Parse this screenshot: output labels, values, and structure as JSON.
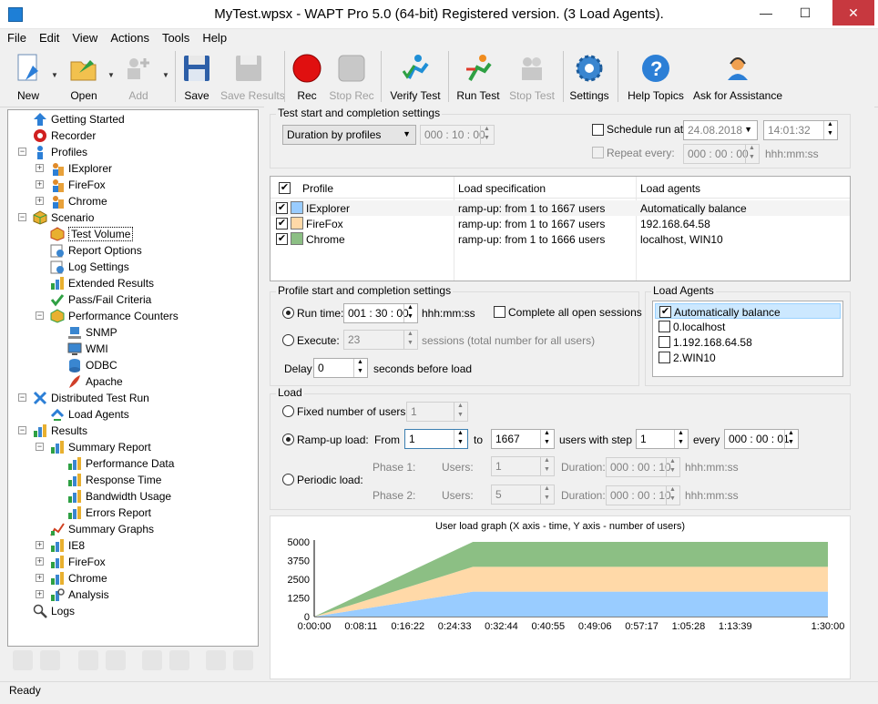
{
  "window": {
    "title": "MyTest.wpsx - WAPT Pro 5.0 (64-bit) Registered version. (3 Load Agents).",
    "min": "—",
    "max": "☐",
    "close": "✕"
  },
  "menu": [
    "File",
    "Edit",
    "View",
    "Actions",
    "Tools",
    "Help"
  ],
  "toolbar": {
    "new": "New",
    "open": "Open",
    "add": "Add",
    "save": "Save",
    "save_results": "Save Results",
    "rec": "Rec",
    "stop_rec": "Stop Rec",
    "verify_test": "Verify Test",
    "run_test": "Run Test",
    "stop_test": "Stop Test",
    "settings": "Settings",
    "help_topics": "Help Topics",
    "ask": "Ask for Assistance"
  },
  "tree": {
    "getting_started": "Getting Started",
    "recorder": "Recorder",
    "profiles": "Profiles",
    "iexplorer": "IExplorer",
    "firefox": "FireFox",
    "chrome": "Chrome",
    "scenario": "Scenario",
    "test_volume": "Test Volume",
    "report_options": "Report Options",
    "log_settings": "Log Settings",
    "extended_results": "Extended Results",
    "pass_fail": "Pass/Fail Criteria",
    "perf_counters": "Performance Counters",
    "snmp": "SNMP",
    "wmi": "WMI",
    "odbc": "ODBC",
    "apache": "Apache",
    "distributed": "Distributed Test Run",
    "load_agents": "Load Agents",
    "results": "Results",
    "summary_report": "Summary Report",
    "performance_data": "Performance Data",
    "response_time": "Response Time",
    "bandwidth_usage": "Bandwidth Usage",
    "errors_report": "Errors Report",
    "summary_graphs": "Summary Graphs",
    "ie8": "IE8",
    "r_firefox": "FireFox",
    "r_chrome": "Chrome",
    "analysis": "Analysis",
    "logs": "Logs"
  },
  "status": "Ready",
  "test_settings": {
    "group": "Test start and completion settings",
    "duration_mode": "Duration by profiles",
    "duration": "000 : 10 : 00",
    "schedule_label": "Schedule run at:",
    "schedule_date": "24.08.2018",
    "schedule_time": "14:01:32",
    "repeat_label": "Repeat every:",
    "repeat_value": "000 : 00 : 00",
    "repeat_unit": "hhh:mm:ss"
  },
  "profiles_table": {
    "headers": [
      "Profile",
      "Load specification",
      "Load agents"
    ],
    "rows": [
      {
        "profile": "IExplorer",
        "spec": "ramp-up: from 1 to 1667 users",
        "agents": "Automatically balance",
        "color": "#99ccff"
      },
      {
        "profile": "FireFox",
        "spec": "ramp-up: from 1 to 1667 users",
        "agents": "192.168.64.58",
        "color": "#ffd9a8"
      },
      {
        "profile": "Chrome",
        "spec": "ramp-up: from 1 to 1666 users",
        "agents": "localhost, WIN10",
        "color": "#8cbf84"
      }
    ]
  },
  "profile_settings": {
    "group": "Profile start and completion settings",
    "run_time_label": "Run time:",
    "run_time": "001 : 30 : 00",
    "run_time_unit": "hhh:mm:ss",
    "complete_open": "Complete all open sessions",
    "execute_label": "Execute:",
    "execute_value": "23",
    "execute_note": "sessions (total number for all users)",
    "delay_label": "Delay",
    "delay_value": "0",
    "delay_note": "seconds before load"
  },
  "load_agents": {
    "group": "Load Agents",
    "items": [
      {
        "label": "Automatically balance",
        "checked": true
      },
      {
        "label": "0.localhost",
        "checked": false
      },
      {
        "label": "1.192.168.64.58",
        "checked": false
      },
      {
        "label": "2.WIN10",
        "checked": false
      }
    ]
  },
  "load": {
    "group": "Load",
    "fixed_label": "Fixed number of users:",
    "fixed_value": "1",
    "ramp_label": "Ramp-up load:",
    "from_label": "From",
    "from_value": "1",
    "to_label": "to",
    "to_value": "1667",
    "step_label": "users with step",
    "step_value": "1",
    "every_label": "every",
    "every_value": "000 : 00 : 01",
    "periodic_label": "Periodic load:",
    "phase1": "Phase 1:",
    "phase2": "Phase 2:",
    "users_label": "Users:",
    "p1_users": "1",
    "p2_users": "5",
    "duration_label": "Duration:",
    "p1_dur": "000 : 00 : 10",
    "p2_dur": "000 : 00 : 10",
    "unit": "hhh:mm:ss"
  },
  "chart_data": {
    "type": "area",
    "title": "User load graph (X axis - time, Y axis - number of users)",
    "xlabel": "",
    "ylabel": "",
    "x": [
      "0:00:00",
      "0:08:11",
      "0:16:22",
      "0:24:33",
      "0:32:44",
      "0:40:55",
      "0:49:06",
      "0:57:17",
      "1:05:28",
      "1:13:39",
      "1:30:00"
    ],
    "x_minutes": [
      0,
      27.8,
      90
    ],
    "ylim": [
      0,
      5000
    ],
    "yticks": [
      0,
      1250,
      2500,
      3750,
      5000
    ],
    "series": [
      {
        "name": "IExplorer",
        "color": "#99ccff",
        "values": [
          0,
          1667,
          1667
        ]
      },
      {
        "name": "FireFox",
        "color": "#ffd9a8",
        "values": [
          0,
          1667,
          1667
        ]
      },
      {
        "name": "Chrome",
        "color": "#8cbf84",
        "values": [
          0,
          1666,
          1666
        ]
      }
    ]
  }
}
